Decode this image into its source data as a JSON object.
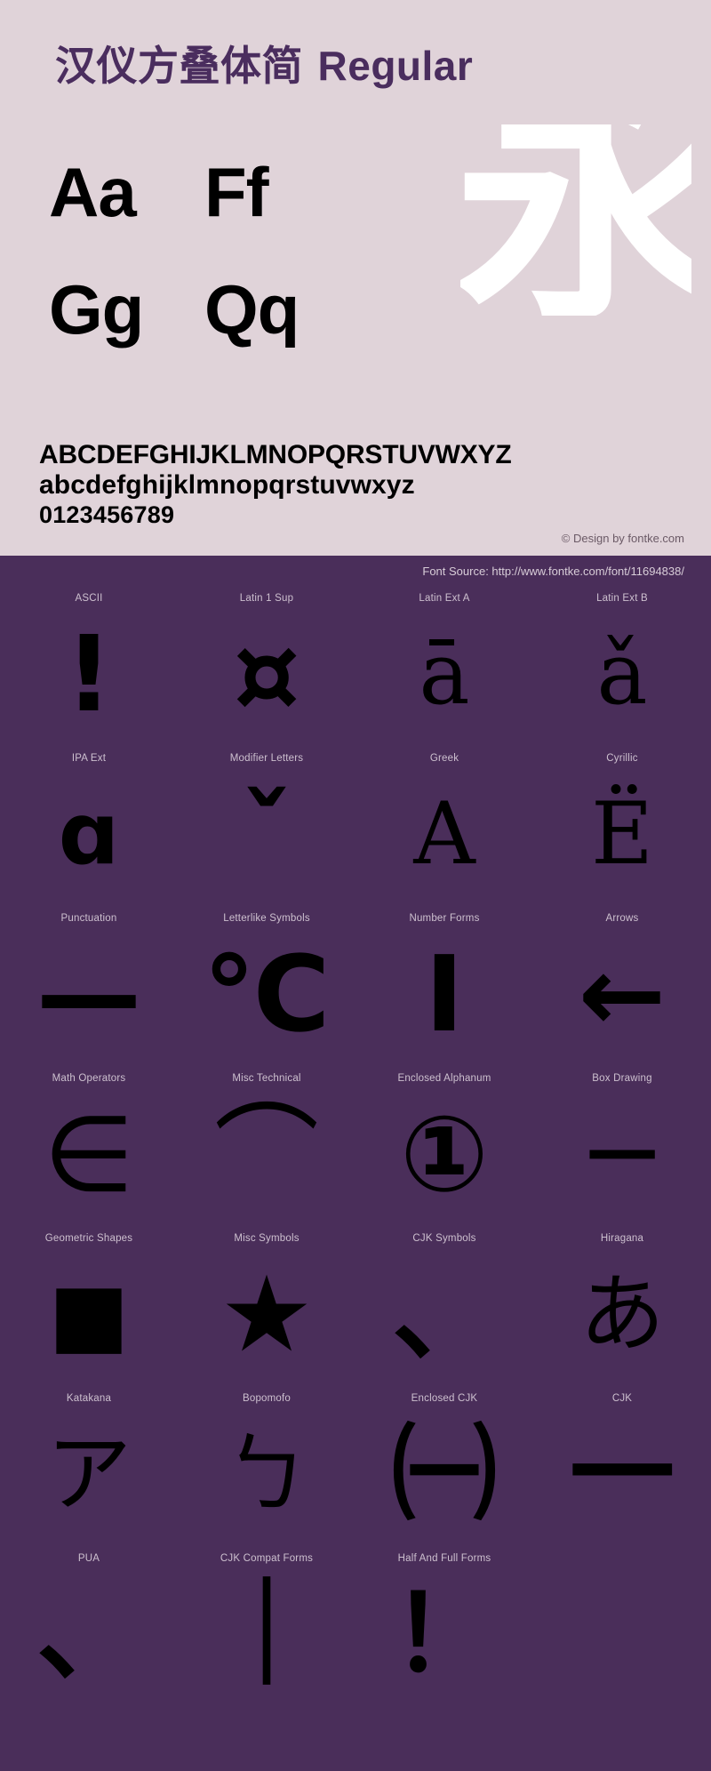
{
  "specimen": {
    "title_cjk": "汉仪方叠体简",
    "title_latin": "Regular",
    "pairs": [
      [
        "Aa",
        "Ff"
      ],
      [
        "Gg",
        "Qq"
      ]
    ],
    "showcase_glyph": "永",
    "alphabet_upper": "ABCDEFGHIJKLMNOPQRSTUVWXYZ",
    "alphabet_lower": "abcdefghijklmnopqrstuvwxyz",
    "digits": "0123456789",
    "credit": "© Design by fontke.com",
    "bg_color": "#e0d3d9",
    "title_color": "#4a2d5e",
    "glyph_color": "#000000",
    "showcase_color": "#ffffff"
  },
  "blocks_panel": {
    "source": "Font Source: http://www.fontke.com/font/11694838/",
    "bg_color": "#4a2e5a",
    "label_color": "#cdc0cf",
    "glyph_color": "#000000",
    "rows": [
      [
        {
          "label": "ASCII",
          "glyph": "!"
        },
        {
          "label": "Latin 1 Sup",
          "glyph": "¤"
        },
        {
          "label": "Latin Ext A",
          "glyph": "ā"
        },
        {
          "label": "Latin Ext B",
          "glyph": "ǎ"
        }
      ],
      [
        {
          "label": "IPA Ext",
          "glyph": "ɑ"
        },
        {
          "label": "Modifier Letters",
          "glyph": "ˇ"
        },
        {
          "label": "Greek",
          "glyph": "Α"
        },
        {
          "label": "Cyrillic",
          "glyph": "Ё"
        }
      ],
      [
        {
          "label": "Punctuation",
          "glyph": "—"
        },
        {
          "label": "Letterlike Symbols",
          "glyph": "℃"
        },
        {
          "label": "Number Forms",
          "glyph": "Ⅰ"
        },
        {
          "label": "Arrows",
          "glyph": "←"
        }
      ],
      [
        {
          "label": "Math Operators",
          "glyph": "∈"
        },
        {
          "label": "Misc Technical",
          "glyph": "⌒"
        },
        {
          "label": "Enclosed Alphanum",
          "glyph": "①"
        },
        {
          "label": "Box Drawing",
          "glyph": "─"
        }
      ],
      [
        {
          "label": "Geometric Shapes",
          "glyph": "■"
        },
        {
          "label": "Misc Symbols",
          "glyph": "★"
        },
        {
          "label": "CJK Symbols",
          "glyph": "、"
        },
        {
          "label": "Hiragana",
          "glyph": "あ"
        }
      ],
      [
        {
          "label": "Katakana",
          "glyph": "ア"
        },
        {
          "label": "Bopomofo",
          "glyph": "ㄅ"
        },
        {
          "label": "Enclosed CJK",
          "glyph": "㈠"
        },
        {
          "label": "CJK",
          "glyph": "一"
        }
      ],
      [
        {
          "label": "PUA",
          "glyph": "、"
        },
        {
          "label": "CJK Compat Forms",
          "glyph": "｜"
        },
        {
          "label": "Half And Full Forms",
          "glyph": "！"
        },
        {
          "label": "",
          "glyph": ""
        }
      ]
    ]
  }
}
